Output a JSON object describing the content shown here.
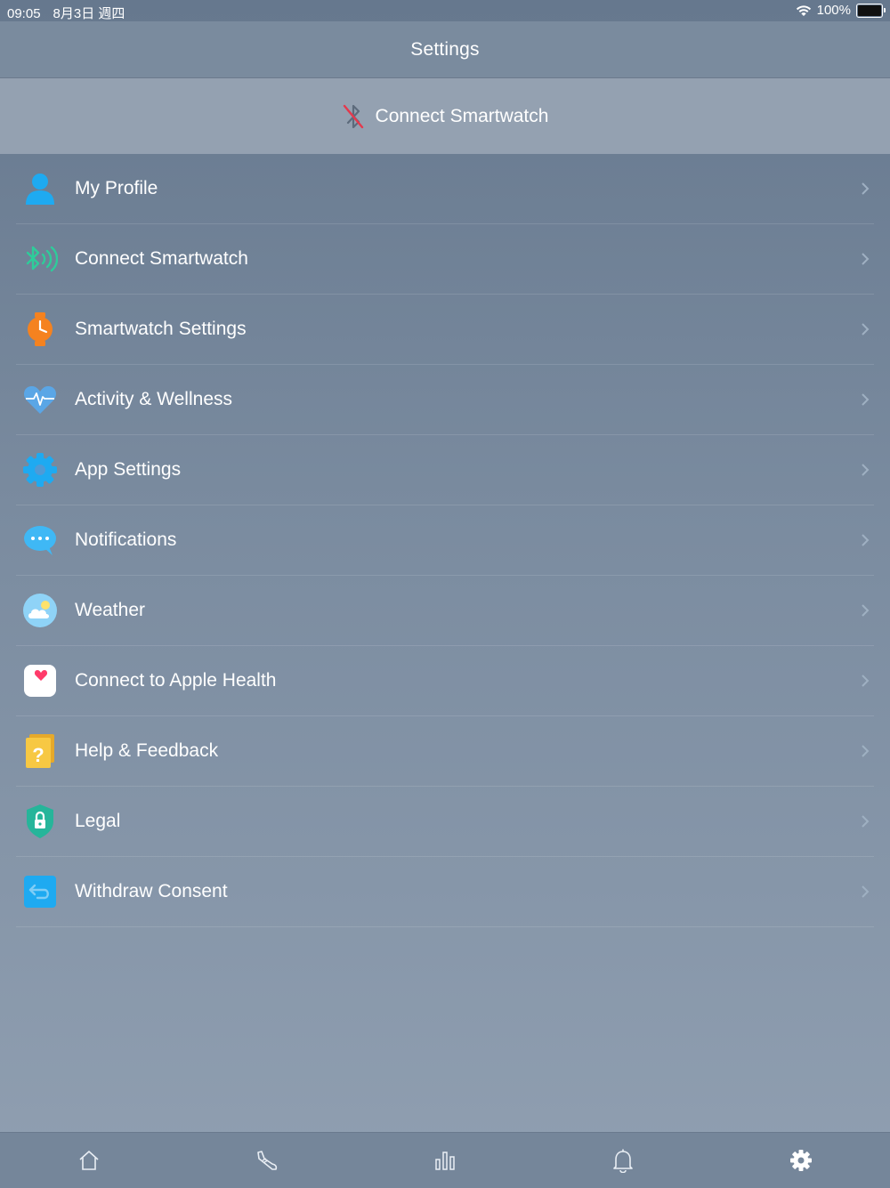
{
  "status_bar": {
    "time": "09:05",
    "date": "8月3日 週四",
    "battery": "100%"
  },
  "nav": {
    "title": "Settings"
  },
  "banner": {
    "label": "Connect Smartwatch",
    "icon": "bluetooth-disabled-icon"
  },
  "settings": {
    "items": [
      {
        "label": "My Profile",
        "icon": "profile-icon"
      },
      {
        "label": "Connect Smartwatch",
        "icon": "bluetooth-icon"
      },
      {
        "label": "Smartwatch Settings",
        "icon": "watch-icon"
      },
      {
        "label": "Activity & Wellness",
        "icon": "heart-pulse-icon"
      },
      {
        "label": "App Settings",
        "icon": "gear-icon"
      },
      {
        "label": "Notifications",
        "icon": "chat-bubble-icon"
      },
      {
        "label": "Weather",
        "icon": "weather-icon"
      },
      {
        "label": "Connect to Apple Health",
        "icon": "apple-health-icon"
      },
      {
        "label": "Help & Feedback",
        "icon": "help-book-icon"
      },
      {
        "label": "Legal",
        "icon": "shield-lock-icon"
      },
      {
        "label": "Withdraw Consent",
        "icon": "undo-icon"
      }
    ]
  },
  "tab_bar": {
    "tabs": [
      {
        "icon": "home-icon"
      },
      {
        "icon": "shoe-icon"
      },
      {
        "icon": "bar-chart-icon"
      },
      {
        "icon": "bell-icon"
      },
      {
        "icon": "gear-icon",
        "active": true
      }
    ]
  },
  "colors": {
    "profile": "#1eaaf1",
    "bluetooth": "#2ecc9a",
    "watch": "#f5821f",
    "heart": "#5aa6e6",
    "gear": "#1eaaf1",
    "chat": "#3fb8f5",
    "weather": "#8fd3f7",
    "help": "#f7c843",
    "legal": "#26b59a",
    "undo": "#1eaaf1"
  }
}
